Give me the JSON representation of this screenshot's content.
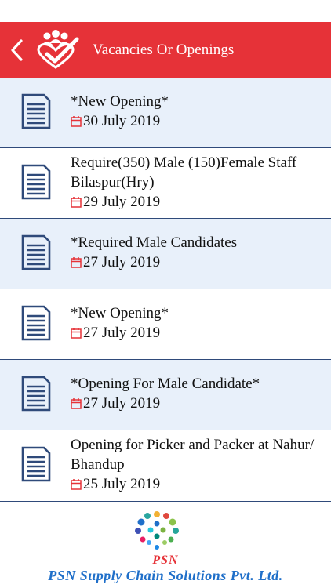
{
  "header": {
    "title": "Vacancies Or Openings",
    "accent_color": "#e63238",
    "back_icon": "chevron-left-icon",
    "logo_icon": "people-heart-icon"
  },
  "vacancies": [
    {
      "title": "*New Opening*",
      "date": "30 July 2019",
      "shaded": true
    },
    {
      "title": "Require(350) Male (150)Female Staff Bilaspur(Hry)",
      "date": "29 July 2019",
      "shaded": false
    },
    {
      "title": "*Required Male Candidates",
      "date": "27 July 2019",
      "shaded": true
    },
    {
      "title": "*New Opening*",
      "date": "27 July 2019",
      "shaded": false
    },
    {
      "title": "*Opening For Male Candidate*",
      "date": "27 July 2019",
      "shaded": true
    },
    {
      "title": "Opening for Picker and Packer at Nahur/ Bhandup",
      "date": "25 July 2019",
      "shaded": false
    }
  ],
  "footer": {
    "brand_short": "PSN",
    "brand_full": "PSN Supply Chain Solutions Pvt. Ltd."
  },
  "colors": {
    "row_shade": "#e8f0fa",
    "divider": "#2f4a7a",
    "brand_blue": "#1f6fc9",
    "calendar_icon": "#e63238"
  }
}
